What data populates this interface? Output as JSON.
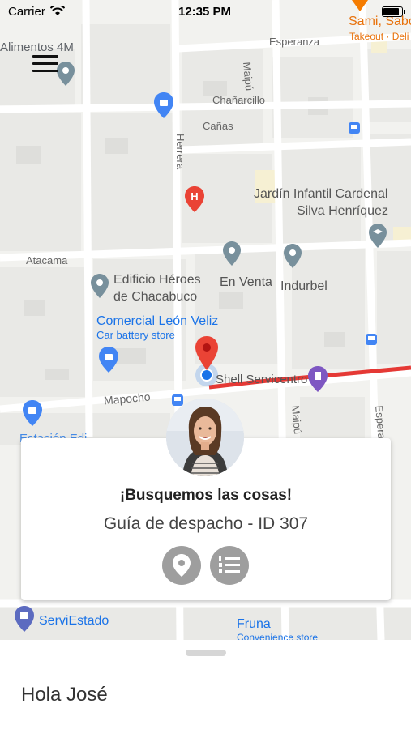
{
  "status_bar": {
    "carrier": "Carrier",
    "time": "12:35 PM"
  },
  "map": {
    "streets": {
      "esperanza": "Esperanza",
      "maipu_top": "Maipú",
      "chanarcillo": "Chañarcillo",
      "canas": "Cañas",
      "herrera": "Herrera",
      "atacama": "Atacama",
      "mapocho": "Mapocho",
      "maipu_bottom": "Maipú",
      "esperanza_right": "Espera"
    },
    "places": {
      "alimentos": "Alimentos 4M",
      "sami_sabor": "Sami, Sabo",
      "takeout": "Takeout · Deli",
      "jardin_line1": "Jardín Infantil Cardenal",
      "jardin_line2": "Silva Henríquez",
      "edificio_line1": "Edificio Héroes",
      "edificio_line2": "de Chacabuco",
      "en_venta": "En Venta",
      "indurbel": "Indurbel",
      "comercial": "Comercial León Veliz",
      "car_battery": "Car battery store",
      "shell": "Shell Servicentro",
      "serviestado": "ServiEstado",
      "fruna": "Fruna",
      "convenience": "Convenience store",
      "edificio_partial": "Estación Edi"
    }
  },
  "card": {
    "title": "¡Busquemos las cosas!",
    "subtitle": "Guía de despacho - ID 307"
  },
  "sheet": {
    "greeting": "Hola José"
  },
  "colors": {
    "route": "#e53935",
    "marker": "#ea4335",
    "user_dot": "#1a73e8",
    "button_gray": "#9e9e9e"
  },
  "icons": {
    "menu": "hamburger-icon",
    "location": "location-pin-icon",
    "list": "numbered-list-icon"
  }
}
